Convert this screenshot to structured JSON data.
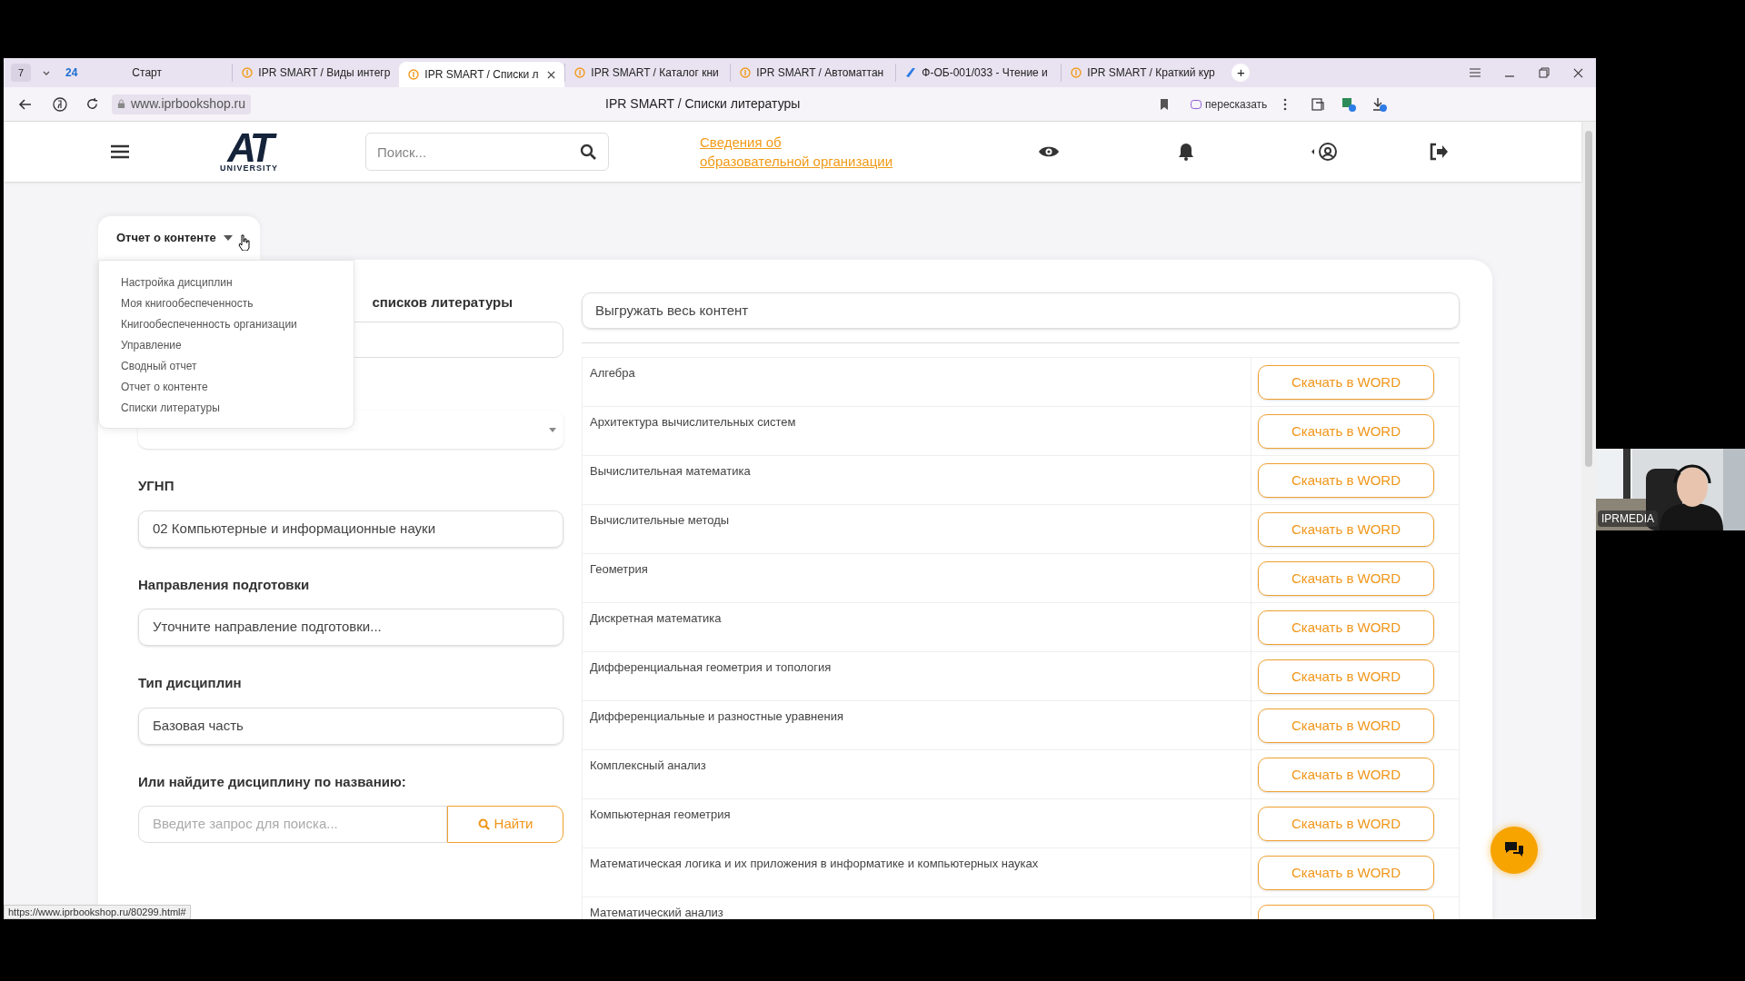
{
  "browser": {
    "tab_counter": "7",
    "tab_count_badge": "24",
    "start_tab": "Старт",
    "tabs": [
      {
        "title": "IPR SMART / Виды интегр",
        "selected": false,
        "kind": "site"
      },
      {
        "title": "IPR SMART / Списки л",
        "selected": true,
        "kind": "site"
      },
      {
        "title": "IPR SMART / Каталог кни",
        "selected": false,
        "kind": "site"
      },
      {
        "title": "IPR SMART / Автоматтан",
        "selected": false,
        "kind": "site"
      },
      {
        "title": "Ф-ОБ-001/033 - Чтение и",
        "selected": false,
        "kind": "doc"
      },
      {
        "title": "IPR SMART / Краткий кур",
        "selected": false,
        "kind": "site"
      }
    ],
    "new_tab": "+",
    "address": "www.iprbookshop.ru",
    "page_title": "IPR SMART / Списки литературы",
    "retell_button": "пересказать",
    "status_url": "https://www.iprbookshop.ru/80299.html#"
  },
  "header": {
    "logo": {
      "letters": "AT",
      "caption": "UNIVERSITY"
    },
    "search": {
      "placeholder": "Поиск..."
    },
    "org_link": [
      "Сведения об",
      "образовательной организации"
    ]
  },
  "menu": {
    "label": "Отчет о контенте",
    "expanded": true,
    "items": [
      {
        "label": "Настройка дисциплин"
      },
      {
        "label": "Моя книгообеспеченность"
      },
      {
        "label": "Книгообеспеченность организации"
      },
      {
        "label": "Управление"
      },
      {
        "label": "Сводный отчет"
      },
      {
        "label": "Отчет о контенте"
      },
      {
        "label": "Списки литературы"
      }
    ]
  },
  "form": {
    "heading": "списков литературы",
    "fields": [
      {
        "label": "УГНП",
        "value": "02 Компьютерные и информационные науки"
      },
      {
        "label": "Направления подготовки",
        "value": "Уточните направление подготовки..."
      },
      {
        "label": "Тип дисциплин",
        "value": "Базовая часть"
      }
    ],
    "search_label": "Или найдите дисциплину по названию:",
    "search": {
      "placeholder": "Введите запрос для поиска..."
    },
    "search_button": "Найти"
  },
  "export": {
    "value": "Выгружать весь контент"
  },
  "disciplines": [
    {
      "name": "Алгебра",
      "button": "Скачать в WORD"
    },
    {
      "name": "Архитектура вычислительных систем",
      "button": "Скачать в WORD"
    },
    {
      "name": "Вычислительная математика",
      "button": "Скачать в WORD"
    },
    {
      "name": "Вычислительные методы",
      "button": "Скачать в WORD"
    },
    {
      "name": "Геометрия",
      "button": "Скачать в WORD"
    },
    {
      "name": "Дискретная математика",
      "button": "Скачать в WORD"
    },
    {
      "name": "Дифференциальная геометрия и топология",
      "button": "Скачать в WORD"
    },
    {
      "name": "Дифференциальные и разностные уравнения",
      "button": "Скачать в WORD"
    },
    {
      "name": "Комплексный анализ",
      "button": "Скачать в WORD"
    },
    {
      "name": "Компьютерная геометрия",
      "button": "Скачать в WORD"
    },
    {
      "name": "Математическая логика и их приложения в информатике и компьютерных науках",
      "button": "Скачать в WORD"
    },
    {
      "name": "Математический анализ"
    }
  ],
  "webcam": {
    "caption": "IPRMEDIA",
    "kind": "picture"
  }
}
